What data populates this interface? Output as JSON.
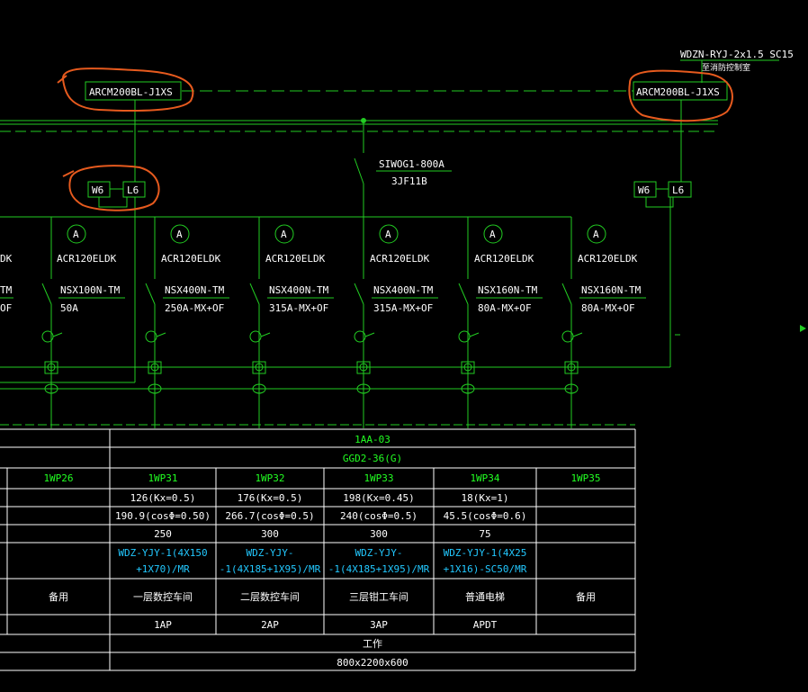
{
  "colors": {
    "background": "#000000",
    "lines": "#22cc22",
    "text": "#ffffff",
    "green_text": "#22ff22",
    "cyan_text": "#22c8ff",
    "markup": "#e65a1e"
  },
  "top": {
    "cable_spec": "WDZN-RYJ-2x1.5 SC15",
    "cable_note": "至消防控制室",
    "device_left": "ARCM200BL-J1XS",
    "device_right": "ARCM200BL-J1XS",
    "breaker_label": "SIWOG1-800A",
    "breaker_sub": "3JF11B",
    "box_left": [
      "W6",
      "L6"
    ],
    "box_right": [
      "W6",
      "L6"
    ]
  },
  "feeders": {
    "partial_meter": "DK",
    "partial_breaker": [
      "TM",
      "OF"
    ],
    "items": [
      {
        "ammeter": "A",
        "meter": "ACR120ELDK",
        "breaker": "NSX100N-TM",
        "rating": "50A"
      },
      {
        "ammeter": "A",
        "meter": "ACR120ELDK",
        "breaker": "NSX400N-TM",
        "rating": "250A-MX+OF"
      },
      {
        "ammeter": "A",
        "meter": "ACR120ELDK",
        "breaker": "NSX400N-TM",
        "rating": "315A-MX+OF"
      },
      {
        "ammeter": "A",
        "meter": "ACR120ELDK",
        "breaker": "NSX400N-TM",
        "rating": "315A-MX+OF"
      },
      {
        "ammeter": "A",
        "meter": "ACR120ELDK",
        "breaker": "NSX160N-TM",
        "rating": "80A-MX+OF"
      },
      {
        "ammeter": "A",
        "meter": "ACR120ELDK",
        "breaker": "NSX160N-TM",
        "rating": "80A-MX+OF"
      }
    ]
  },
  "table": {
    "panel_id": "1AA-03",
    "panel_model": "GGD2-36(G)",
    "circuits": [
      "1WP26",
      "1WP31",
      "1WP32",
      "1WP33",
      "1WP34",
      "1WP35"
    ],
    "loads": [
      "",
      "126(Kx=0.5)",
      "176(Kx=0.5)",
      "198(Kx=0.45)",
      "18(Kx=1)",
      ""
    ],
    "currents": [
      "",
      "190.9(cosΦ=0.50)",
      "266.7(cosΦ=0.5)",
      "240(cosΦ=0.5)",
      "45.5(cosΦ=0.6)",
      ""
    ],
    "settings": [
      "",
      "250",
      "300",
      "300",
      "75",
      ""
    ],
    "cables_line1": [
      "",
      "WDZ-YJY-1(4X150",
      "WDZ-YJY-",
      "WDZ-YJY-",
      "WDZ-YJY-1(4X25",
      ""
    ],
    "cables_line2": [
      "",
      "+1X70)/MR",
      "-1(4X185+1X95)/MR",
      "-1(4X185+1X95)/MR",
      "+1X16)-SC50/MR",
      ""
    ],
    "uses": [
      "备用",
      "一层数控车间",
      "二层数控车间",
      "三层钳工车间",
      "普通电梯",
      "备用"
    ],
    "codes": [
      "",
      "1AP",
      "2AP",
      "3AP",
      "APDT",
      ""
    ],
    "footer_label": "工作",
    "footer_size": "800x2200x600"
  }
}
